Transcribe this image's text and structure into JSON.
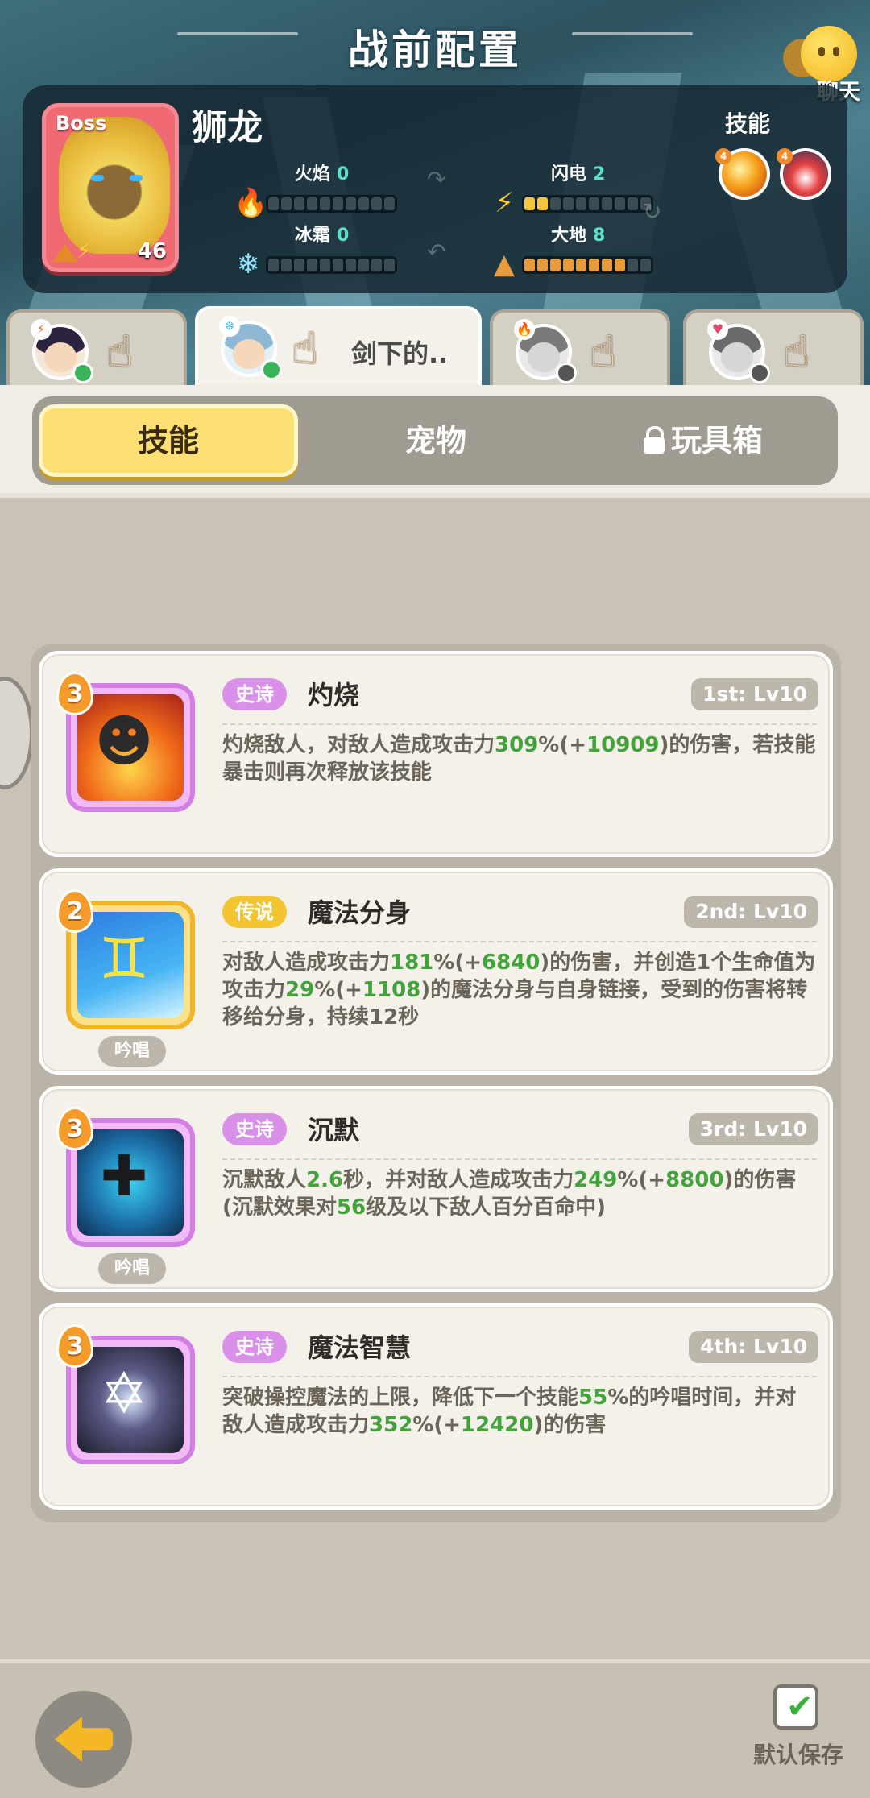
{
  "header": {
    "title": "战前配置",
    "chat_label": "聊天"
  },
  "boss": {
    "tag": "Boss",
    "name": "狮龙",
    "level": "46",
    "elements": [
      {
        "label": "火焰",
        "value": "0"
      },
      {
        "label": "闪电",
        "value": "2"
      },
      {
        "label": "冰霜",
        "value": "0"
      },
      {
        "label": "大地",
        "value": "8"
      }
    ],
    "skills_label": "技能"
  },
  "hero_tabs": [
    {
      "name": "",
      "active": false
    },
    {
      "name": "剑下的..",
      "active": true
    },
    {
      "name": "",
      "active": false
    },
    {
      "name": "",
      "active": false
    }
  ],
  "categories": {
    "skill": "技能",
    "pet": "宠物",
    "toybox": "玩具箱",
    "active": "技能"
  },
  "skills": [
    {
      "rank": "3",
      "rarity": "史诗",
      "name": "灼烧",
      "slot": "1st: Lv10",
      "chant": "",
      "desc": [
        {
          "t": "灼烧敌人，对敌人造成攻击力"
        },
        {
          "t": "309",
          "hl": true
        },
        {
          "t": "%(+"
        },
        {
          "t": "10909",
          "hl": true
        },
        {
          "t": ")的伤害，若技能暴击则再次释放该技能"
        }
      ]
    },
    {
      "rank": "2",
      "rarity": "传说",
      "name": "魔法分身",
      "slot": "2nd: Lv10",
      "chant": "吟唱",
      "desc": [
        {
          "t": "对敌人造成攻击力"
        },
        {
          "t": "181",
          "hl": true
        },
        {
          "t": "%(+"
        },
        {
          "t": "6840",
          "hl": true
        },
        {
          "t": ")的伤害，并创造1个生命值为攻击力"
        },
        {
          "t": "29",
          "hl": true
        },
        {
          "t": "%(+"
        },
        {
          "t": "1108",
          "hl": true
        },
        {
          "t": ")的魔法分身与自身链接，受到的伤害将转移给分身，持续12秒"
        }
      ]
    },
    {
      "rank": "3",
      "rarity": "史诗",
      "name": "沉默",
      "slot": "3rd: Lv10",
      "chant": "吟唱",
      "desc": [
        {
          "t": "沉默敌人"
        },
        {
          "t": "2.6",
          "hl": true
        },
        {
          "t": "秒，并对敌人造成攻击力"
        },
        {
          "t": "249",
          "hl": true
        },
        {
          "t": "%(+"
        },
        {
          "t": "8800",
          "hl": true
        },
        {
          "t": ")的伤害(沉默效果对"
        },
        {
          "t": "56",
          "hl": true
        },
        {
          "t": "级及以下敌人百分百命中)"
        }
      ]
    },
    {
      "rank": "3",
      "rarity": "史诗",
      "name": "魔法智慧",
      "slot": "4th: Lv10",
      "chant": "",
      "desc": [
        {
          "t": "突破操控魔法的上限，降低下一个技能"
        },
        {
          "t": "55",
          "hl": true
        },
        {
          "t": "%的吟唱时间，并对敌人造成攻击力"
        },
        {
          "t": "352",
          "hl": true
        },
        {
          "t": "%(+"
        },
        {
          "t": "12420",
          "hl": true
        },
        {
          "t": ")的伤害"
        }
      ]
    }
  ],
  "bottom": {
    "default_save_label": "默认保存",
    "default_save_checked": true
  },
  "colors": {
    "highlight": "#43a33b",
    "epic": "#d890e8",
    "legend": "#f3c531",
    "active_tab": "#fde074"
  },
  "icons": {
    "chat": "emoji-face-icon",
    "fire": "flame-icon",
    "lightning": "lightning-icon",
    "frost": "snowflake-icon",
    "earth": "mountain-icon",
    "tap": "pointing-hand-icon",
    "lock": "lock-icon",
    "back": "back-arrow-icon",
    "check": "checkmark-icon"
  }
}
